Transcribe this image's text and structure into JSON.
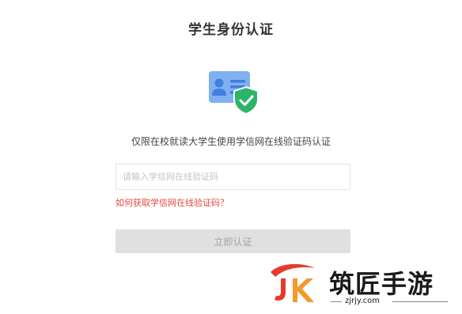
{
  "page": {
    "title": "学生身份认证",
    "description": "仅限在校就读大学生使用学信网在线验证码认证"
  },
  "form": {
    "code_input": {
      "placeholder": "请输入学信网在线验证码",
      "value": ""
    },
    "help_link": "如何获取学信网在线验证码？",
    "submit_label": "立即认证",
    "submit_enabled": false
  },
  "watermark": {
    "brand_name": "筑匠手游",
    "url": "zjrjy.com",
    "logo_text": "JK"
  },
  "colors": {
    "link_red": "#e2483d",
    "badge_green": "#2eb36a",
    "card_blue": "#7fb0ef",
    "button_disabled_bg": "#e0e0e0",
    "logo_red": "#e53a2f",
    "logo_orange": "#f39a2b"
  },
  "icons": {
    "id_card": "id-card-icon",
    "verified_badge": "shield-check-icon"
  }
}
